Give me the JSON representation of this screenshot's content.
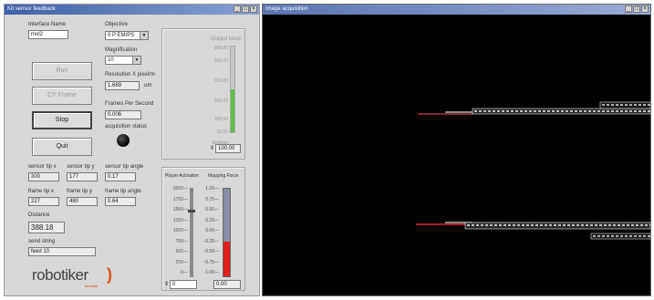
{
  "left_window": {
    "title": "Kit sensor feedback",
    "window_controls": [
      "_",
      "□",
      "×"
    ],
    "interface_name": {
      "label": "Interface Name",
      "value": "mol2"
    },
    "objective": {
      "label": "Objective",
      "value": "0 P EM/PS"
    },
    "magnification": {
      "label": "Magnification",
      "value": "10"
    },
    "resolution": {
      "label": "Resolution X pixel/m",
      "value": "1.689",
      "unit": "um"
    },
    "frames_per_second": {
      "label": "Frames Per Second",
      "value": "0.006"
    },
    "buttons": {
      "run": "Run",
      "cy_frame": "CY Frame",
      "stop": "Stop",
      "quit": "Quit"
    },
    "acquisition_status_label": "acquisition status",
    "coords": {
      "row1_labels": [
        "sensor tip x",
        "sensor tip y",
        "sensor tip angle"
      ],
      "row1_values": [
        "300",
        "177",
        "0.17"
      ],
      "row2_labels": [
        "frame tip x",
        "frame tip y",
        "frame tip angle"
      ],
      "row2_values": [
        "227",
        "480",
        "0.64"
      ]
    },
    "distance": {
      "label": "Distance",
      "value": "388.18"
    },
    "send_string": {
      "label": "send string",
      "value": "feed 10"
    },
    "logo": {
      "text": "robotiker",
      "subtext": "tecnalia",
      "accent": "#d9531e"
    },
    "force_range": {
      "label": "Output force",
      "ticks": [
        "300.00",
        "250.00",
        "200.00",
        "150.00",
        "100.00",
        "50.00",
        "Nothing"
      ],
      "value": "100.00",
      "level": 0.5,
      "color": "#5fbf4a"
    },
    "player_activation": {
      "label": "Player Activation",
      "ticks": [
        "2000",
        "1750",
        "1500",
        "1250",
        "1000",
        "750",
        "500",
        "250",
        "0"
      ],
      "value": "0",
      "level": 0.75
    },
    "mapping_force": {
      "label": "Mapping Force",
      "ticks": [
        "1.00",
        "0.75",
        "0.50",
        "0.25",
        "0.00",
        "-0.25",
        "-0.50",
        "-0.75",
        "-1.00"
      ],
      "value": "0.00",
      "level": 0.4,
      "color": "#e02020"
    }
  },
  "right_window": {
    "title": "Image acquisition",
    "window_controls": [
      "_",
      "□",
      "×"
    ]
  }
}
